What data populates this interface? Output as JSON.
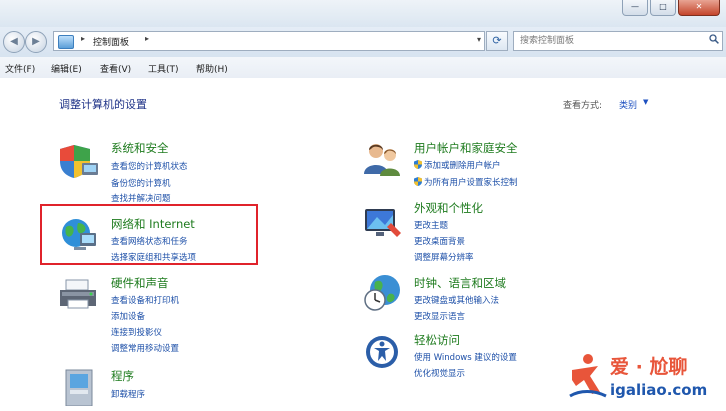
{
  "window": {
    "min_glyph": "—",
    "max_glyph": "□",
    "close_glyph": "✕"
  },
  "nav": {
    "back_glyph": "◀",
    "forward_glyph": "▶",
    "breadcrumb": "控制面板",
    "arrow": "▸",
    "dropdown": "▾",
    "refresh_glyph": "⟳",
    "search_placeholder": "搜索控制面板"
  },
  "menu": [
    {
      "label": "文件(F)"
    },
    {
      "label": "编辑(E)"
    },
    {
      "label": "查看(V)"
    },
    {
      "label": "工具(T)"
    },
    {
      "label": "帮助(H)"
    }
  ],
  "page": {
    "title": "调整计算机的设置",
    "view_by_label": "查看方式:",
    "view_by_value": "类别",
    "caret": "▼"
  },
  "categories": {
    "security": {
      "title": "系统和安全",
      "tasks": [
        "查看您的计算机状态",
        "备份您的计算机",
        "查找并解决问题"
      ]
    },
    "network": {
      "title": "网络和 Internet",
      "tasks": [
        "查看网络状态和任务",
        "选择家庭组和共享选项"
      ]
    },
    "hardware": {
      "title": "硬件和声音",
      "tasks": [
        "查看设备和打印机",
        "添加设备",
        "连接到投影仪",
        "调整常用移动设置"
      ]
    },
    "programs": {
      "title": "程序",
      "tasks": [
        "卸载程序"
      ]
    },
    "accounts": {
      "title": "用户帐户和家庭安全",
      "tasks": [
        "添加或删除用户帐户",
        "为所有用户设置家长控制"
      ]
    },
    "appearance": {
      "title": "外观和个性化",
      "tasks": [
        "更改主题",
        "更改桌面背景",
        "调整屏幕分辨率"
      ]
    },
    "clock": {
      "title": "时钟、语言和区域",
      "tasks": [
        "更改键盘或其他输入法",
        "更改显示语言"
      ]
    },
    "ease": {
      "title": "轻松访问",
      "tasks": [
        "使用 Windows 建议的设置",
        "优化视觉显示"
      ]
    }
  },
  "watermark": {
    "line1": "爱 · 尬聊",
    "line2": "igaliao.com"
  },
  "colors": {
    "category_title": "#1e7b1e",
    "task_link": "#1e50a8",
    "highlight_box": "#e0232b"
  }
}
